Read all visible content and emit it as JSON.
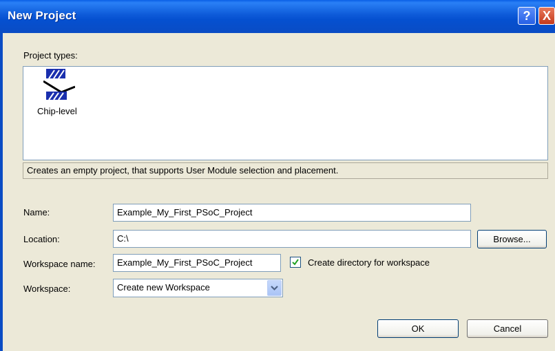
{
  "window": {
    "title": "New Project",
    "help_glyph": "?",
    "close_glyph": "X"
  },
  "project_types": {
    "label": "Project types:",
    "items": [
      {
        "label": "Chip-level",
        "icon": "chip-level-icon"
      }
    ],
    "description": "Creates an empty project, that supports User Module selection and placement."
  },
  "form": {
    "name_label": "Name:",
    "name_value": "Example_My_First_PSoC_Project",
    "location_label": "Location:",
    "location_value": "C:\\",
    "browse_label": "Browse...",
    "workspace_name_label": "Workspace name:",
    "workspace_name_value": "Example_My_First_PSoC_Project",
    "create_dir_label": "Create directory for workspace",
    "create_dir_checked": true,
    "workspace_label": "Workspace:",
    "workspace_value": "Create new Workspace"
  },
  "buttons": {
    "ok": "OK",
    "cancel": "Cancel"
  },
  "colors": {
    "titlebar": "#0a50d0",
    "dialog_bg": "#ece9d8",
    "field_border": "#7f9db9",
    "check": "#21a121"
  }
}
